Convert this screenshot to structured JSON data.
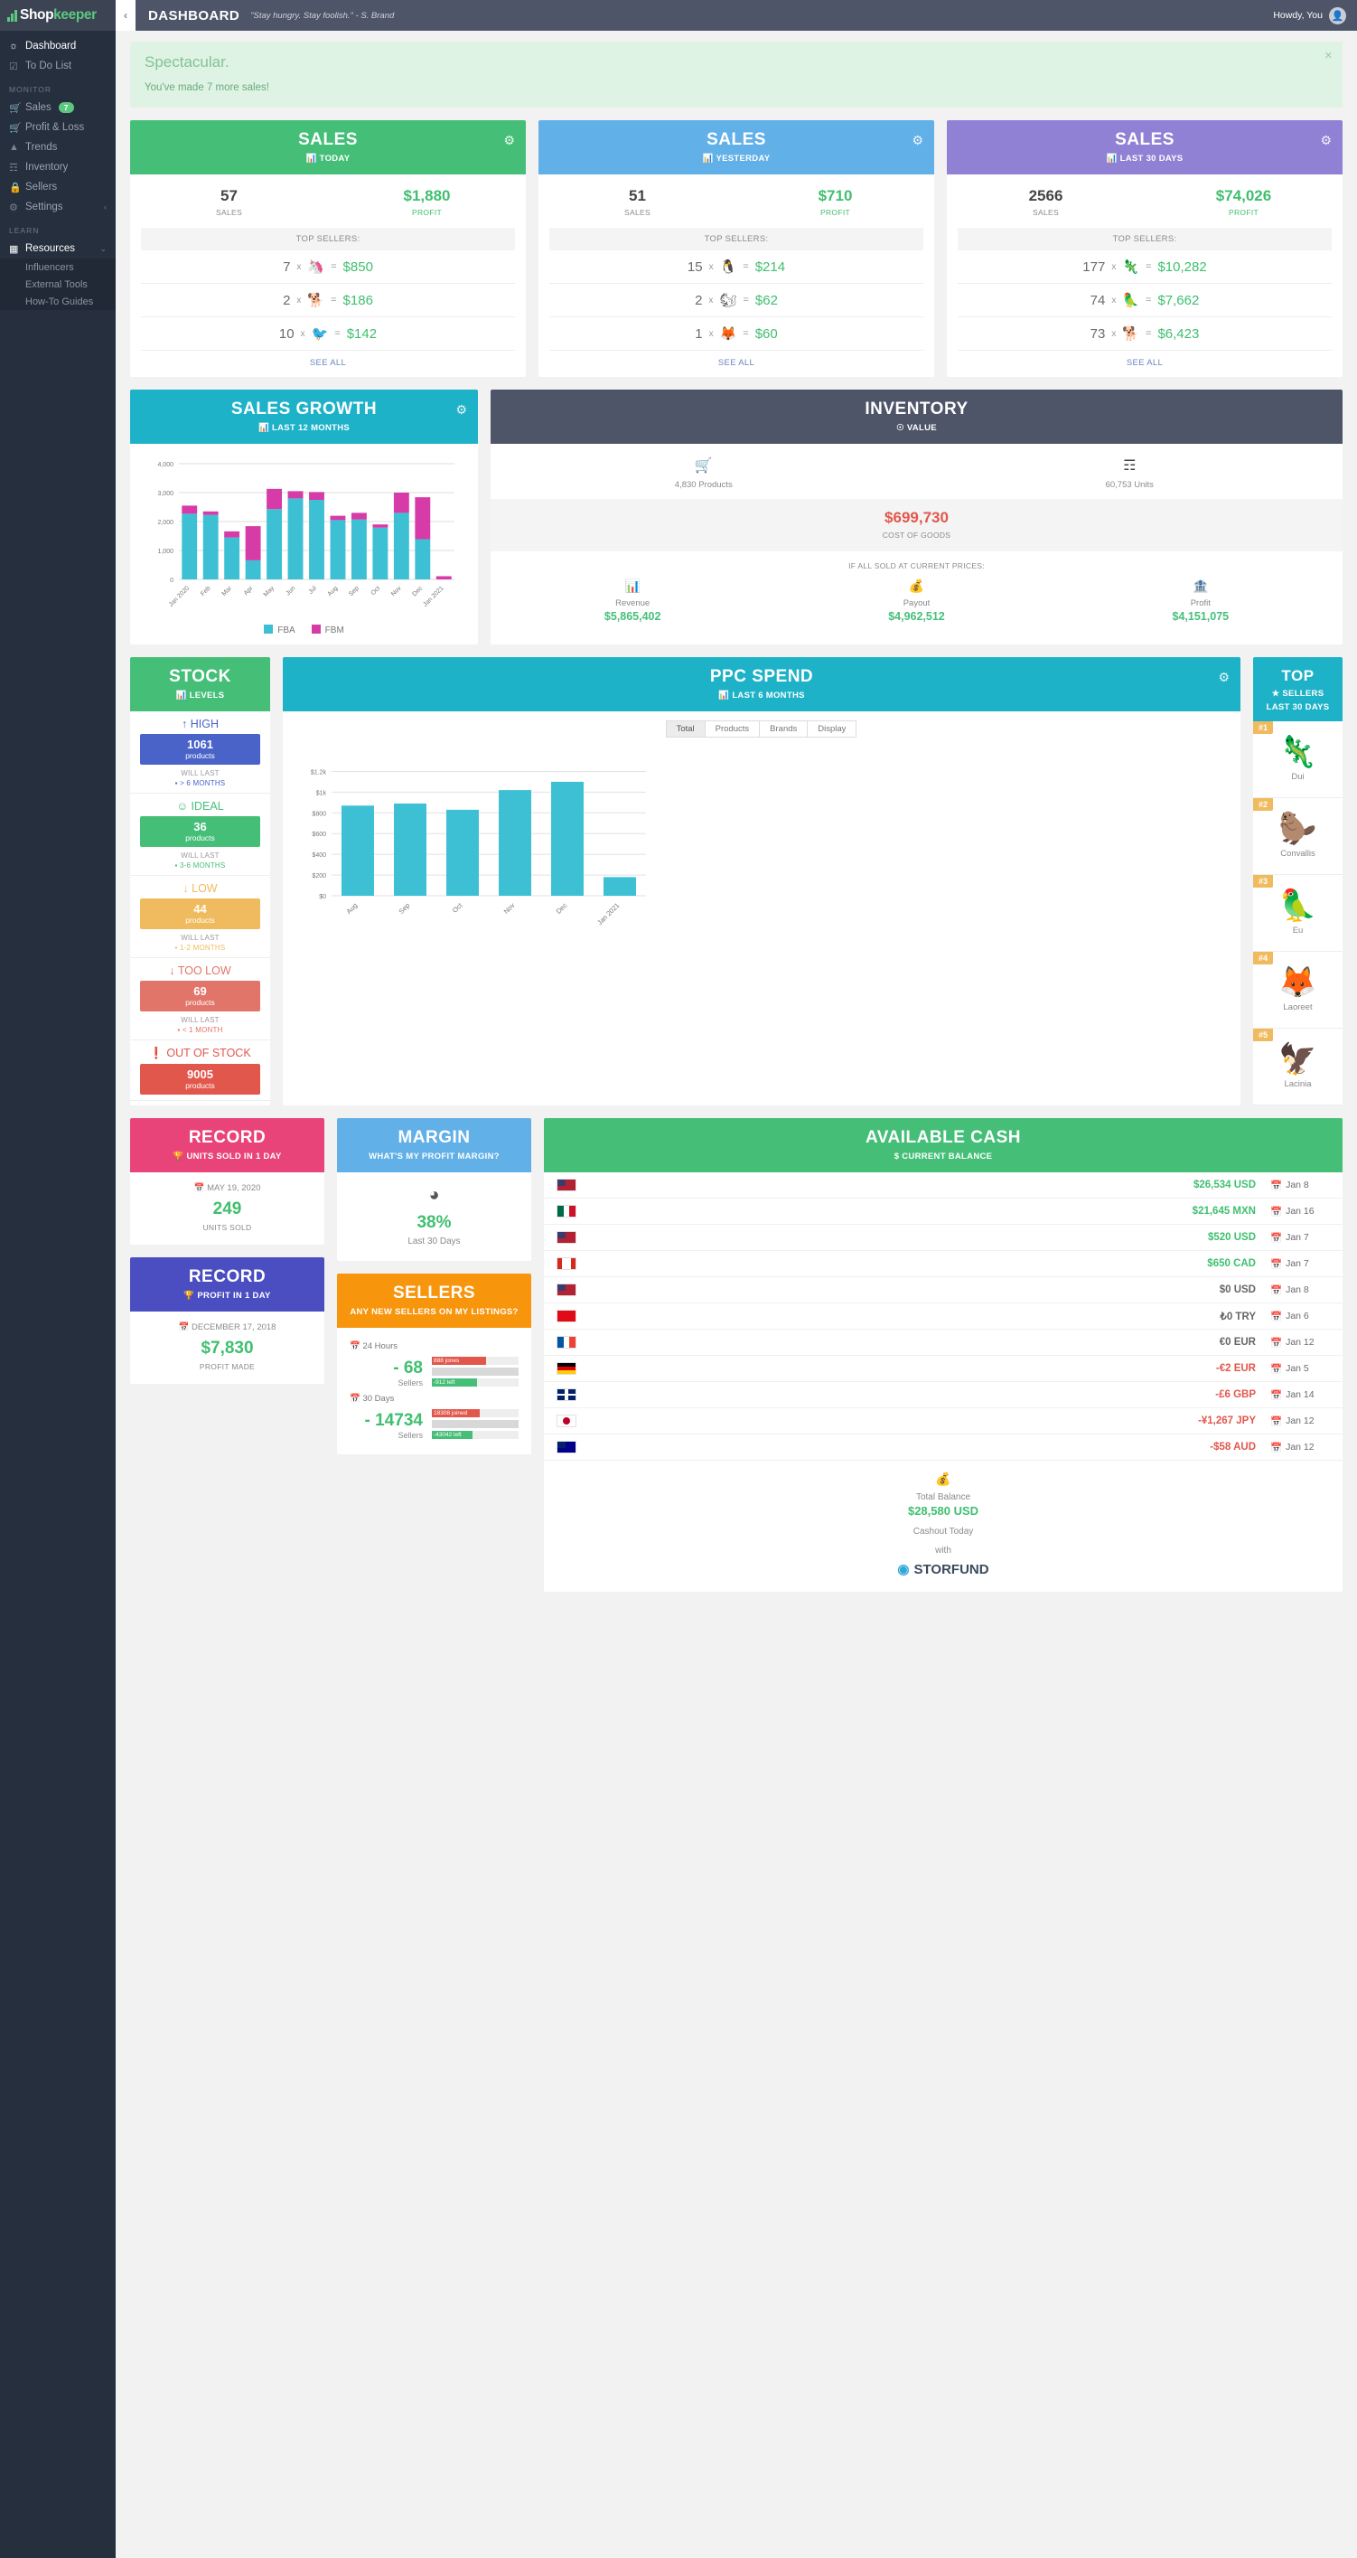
{
  "brand": {
    "word1": "Shop",
    "word2": "keeper"
  },
  "topbar": {
    "title": "DASHBOARD",
    "quote": "\"Stay hungry. Stay foolish.\" - S. Brand",
    "howdy": "Howdy, You",
    "collapse_icon": "chevron-left-icon"
  },
  "sidebar": {
    "items": [
      {
        "label": "Dashboard",
        "icon": "gauge-icon",
        "active": true
      },
      {
        "label": "To Do List",
        "icon": "checkbox-icon",
        "active": false
      }
    ],
    "monitor_label": "MONITOR",
    "monitor": [
      {
        "label": "Sales",
        "icon": "cart-icon",
        "badge": "7"
      },
      {
        "label": "Profit & Loss",
        "icon": "cart-icon",
        "badge": ""
      },
      {
        "label": "Trends",
        "icon": "chart-icon",
        "badge": ""
      },
      {
        "label": "Inventory",
        "icon": "boxes-icon",
        "badge": ""
      },
      {
        "label": "Sellers",
        "icon": "lock-icon",
        "badge": ""
      },
      {
        "label": "Settings",
        "icon": "gear-icon",
        "badge": "",
        "chevron": "‹"
      }
    ],
    "learn_label": "LEARN",
    "resources": {
      "label": "Resources",
      "icon": "grid-icon",
      "chevron": "⌄"
    },
    "sub_items": [
      {
        "label": "Influencers"
      },
      {
        "label": "External Tools"
      },
      {
        "label": "How-To Guides"
      }
    ]
  },
  "alert": {
    "title": "Spectacular.",
    "body": "You've made 7 more sales!",
    "close_icon": "close-icon"
  },
  "sales_cards": [
    {
      "title": "SALES",
      "period": "TODAY",
      "color": "#45bf78",
      "sales": "57",
      "sales_label": "SALES",
      "profit": "$1,880",
      "profit_label": "PROFIT",
      "top_label": "TOP SELLERS:",
      "rows": [
        {
          "qty": "7",
          "emoji": "🦄",
          "amount": "$850"
        },
        {
          "qty": "2",
          "emoji": "🐕",
          "amount": "$186"
        },
        {
          "qty": "10",
          "emoji": "🐦",
          "amount": "$142"
        }
      ],
      "see_all": "SEE ALL"
    },
    {
      "title": "SALES",
      "period": "YESTERDAY",
      "color": "#62b0e8",
      "sales": "51",
      "sales_label": "SALES",
      "profit": "$710",
      "profit_label": "PROFIT",
      "top_label": "TOP SELLERS:",
      "rows": [
        {
          "qty": "15",
          "emoji": "🐧",
          "amount": "$214"
        },
        {
          "qty": "2",
          "emoji": "🐿",
          "amount": "$62"
        },
        {
          "qty": "1",
          "emoji": "🦊",
          "amount": "$60"
        }
      ],
      "see_all": "SEE ALL"
    },
    {
      "title": "SALES",
      "period": "LAST 30 DAYS",
      "color": "#9181d4",
      "sales": "2566",
      "sales_label": "SALES",
      "profit": "$74,026",
      "profit_label": "PROFIT",
      "top_label": "TOP SELLERS:",
      "rows": [
        {
          "qty": "177",
          "emoji": "🦎",
          "amount": "$10,282"
        },
        {
          "qty": "74",
          "emoji": "🦜",
          "amount": "$7,662"
        },
        {
          "qty": "73",
          "emoji": "🐕",
          "amount": "$6,423"
        }
      ],
      "see_all": "SEE ALL"
    }
  ],
  "growth": {
    "title": "SALES GROWTH",
    "period": "LAST 12 MONTHS",
    "color": "#1eb2c8",
    "gear_icon": "gear-icon"
  },
  "inventory": {
    "title": "INVENTORY",
    "period": "VALUE",
    "color": "#4e5568",
    "products_value": "4,830 Products",
    "products_icon": "basket-icon",
    "units_value": "60,753 Units",
    "units_icon": "boxes-icon",
    "cost_value": "$699,730",
    "cost_label": "COST OF GOODS",
    "if_label": "IF ALL SOLD AT CURRENT PRICES:",
    "three": [
      {
        "icon": "bar-chart-icon",
        "label": "Revenue",
        "value": "$5,865,402",
        "color": "#45bf78"
      },
      {
        "icon": "money-icon",
        "label": "Payout",
        "value": "$4,962,512",
        "color": "#45bf78"
      },
      {
        "icon": "bank-icon",
        "label": "Profit",
        "value": "$4,151,075",
        "color": "#45bf78"
      }
    ]
  },
  "stock": {
    "title": "STOCK",
    "period": "LEVELS",
    "color": "#45bf78",
    "items": [
      {
        "icon": "↑",
        "name": "HIGH",
        "n": "1061",
        "u": "products",
        "color": "#4a63c8",
        "tcolor": "#4a63c8",
        "will": "WILL LAST",
        "dur": "▪ > 6 MONTHS"
      },
      {
        "icon": "☺",
        "name": "IDEAL",
        "n": "36",
        "u": "products",
        "color": "#45bf78",
        "tcolor": "#45bf78",
        "will": "WILL LAST",
        "dur": "▪ 3-6 MONTHS"
      },
      {
        "icon": "↓",
        "name": "LOW",
        "n": "44",
        "u": "products",
        "color": "#f0bb5e",
        "tcolor": "#f0bb5e",
        "will": "WILL LAST",
        "dur": "▪ 1-2 MONTHS"
      },
      {
        "icon": "↓",
        "name": "TOO LOW",
        "n": "69",
        "u": "products",
        "color": "#e2756a",
        "tcolor": "#e2756a",
        "will": "WILL LAST",
        "dur": "▪ < 1 MONTH"
      },
      {
        "icon": "❗",
        "name": "OUT OF STOCK",
        "n": "9005",
        "u": "products",
        "color": "#e2574c",
        "tcolor": "#e2574c",
        "will": "",
        "dur": ""
      }
    ]
  },
  "ppc": {
    "title": "PPC SPEND",
    "period": "LAST 6 MONTHS",
    "color": "#1eb2c8",
    "tabs": [
      {
        "label": "Total",
        "on": true
      },
      {
        "label": "Products",
        "on": false
      },
      {
        "label": "Brands",
        "on": false
      },
      {
        "label": "Display",
        "on": false
      }
    ]
  },
  "top_sellers": {
    "title": "TOP",
    "line2": "SELLERS",
    "line3": "LAST 30 DAYS",
    "color": "#1eb2c8",
    "items": [
      {
        "rank": "#1",
        "emoji": "🦎",
        "name": "Dui",
        "color": "#f0bb5e"
      },
      {
        "rank": "#2",
        "emoji": "🦫",
        "name": "Convallis",
        "color": "#f0bb5e"
      },
      {
        "rank": "#3",
        "emoji": "🦜",
        "name": "Eu",
        "color": "#f0bb5e"
      },
      {
        "rank": "#4",
        "emoji": "🦊",
        "name": "Laoreet",
        "color": "#f0bb5e"
      },
      {
        "rank": "#5",
        "emoji": "🦅",
        "name": "Lacinia",
        "color": "#f0bb5e"
      }
    ]
  },
  "record_units": {
    "title": "RECORD",
    "period": "UNITS SOLD IN 1 DAY",
    "color": "#e9447a",
    "date": "MAY 19, 2020",
    "value": "249",
    "label": "UNITS SOLD",
    "date_icon": "calendar-icon",
    "trophy_icon": "trophy-icon"
  },
  "record_profit": {
    "title": "RECORD",
    "period": "PROFIT IN 1 DAY",
    "color": "#4a4ec0",
    "date": "DECEMBER 17, 2018",
    "value": "$7,830",
    "label": "PROFIT MADE",
    "date_icon": "calendar-icon",
    "trophy_icon": "trophy-icon"
  },
  "margin": {
    "title": "MARGIN",
    "period": "WHAT'S MY PROFIT MARGIN?",
    "color": "#62b0e8",
    "value": "38%",
    "sub": "Last 30 Days",
    "pie_icon": "pie-chart-icon"
  },
  "sellers": {
    "title": "SELLERS",
    "period": "ANY NEW SELLERS ON MY LISTINGS?",
    "color": "#f7950d",
    "groups": [
      {
        "head": "24 Hours",
        "head_icon": "calendar-icon",
        "num": "- 68",
        "sub": "Sellers",
        "bars": [
          {
            "label": "888 jones",
            "pct": 62,
            "color": "#e2574c"
          },
          {
            "label": "",
            "pct": 100,
            "color": "#d8d8d8"
          },
          {
            "label": "-912 left",
            "pct": 52,
            "color": "#45bf78"
          }
        ]
      },
      {
        "head": "30 Days",
        "head_icon": "calendar-icon",
        "num": "- 14734",
        "sub": "Sellers",
        "bars": [
          {
            "label": "18308 joined",
            "pct": 55,
            "color": "#e2574c"
          },
          {
            "label": "",
            "pct": 100,
            "color": "#d8d8d8"
          },
          {
            "label": "-43042 left",
            "pct": 47,
            "color": "#45bf78"
          }
        ]
      }
    ]
  },
  "cash": {
    "title": "AVAILABLE CASH",
    "period": "CURRENT BALANCE",
    "color": "#45bf78",
    "currency_icon": "dollar-icon",
    "rows": [
      {
        "flag": "us",
        "amount": "$26,534 USD",
        "date": "Jan 8",
        "color": "#3fbf6f"
      },
      {
        "flag": "mx",
        "amount": "$21,645 MXN",
        "date": "Jan 16",
        "color": "#3fbf6f"
      },
      {
        "flag": "us",
        "amount": "$520 USD",
        "date": "Jan 7",
        "color": "#3fbf6f"
      },
      {
        "flag": "ca",
        "amount": "$650 CAD",
        "date": "Jan 7",
        "color": "#3fbf6f"
      },
      {
        "flag": "us",
        "amount": "$0 USD",
        "date": "Jan 8",
        "color": "#666"
      },
      {
        "flag": "tr",
        "amount": "₺0 TRY",
        "date": "Jan 6",
        "color": "#666"
      },
      {
        "flag": "fr",
        "amount": "€0 EUR",
        "date": "Jan 12",
        "color": "#666"
      },
      {
        "flag": "de",
        "amount": "-€2 EUR",
        "date": "Jan 5",
        "color": "#e2574c"
      },
      {
        "flag": "gb",
        "amount": "-£6 GBP",
        "date": "Jan 14",
        "color": "#e2574c"
      },
      {
        "flag": "jp",
        "amount": "-¥1,267 JPY",
        "date": "Jan 12",
        "color": "#e2574c"
      },
      {
        "flag": "au",
        "amount": "-$58 AUD",
        "date": "Jan 12",
        "color": "#e2574c"
      }
    ],
    "total_label": "Total Balance",
    "total_value": "$28,580 USD",
    "cashout_label": "Cashout Today",
    "with_label": "with",
    "partner": "STORFUND",
    "partner_icon": "storfund-logo-icon"
  },
  "chart_data": [
    {
      "type": "bar",
      "id": "sales-growth",
      "title": "SALES GROWTH",
      "subtitle": "LAST 12 MONTHS",
      "stacked": true,
      "categories": [
        "Jan 2020",
        "Feb",
        "Mar",
        "Apr",
        "May",
        "Jun",
        "Jul",
        "Aug",
        "Sep",
        "Oct",
        "Nov",
        "Dec",
        "Jan 2021"
      ],
      "series": [
        {
          "name": "FBA",
          "color": "#3dc0d4",
          "values": [
            2270,
            2230,
            1450,
            660,
            2430,
            2800,
            2750,
            2050,
            2070,
            1790,
            2300,
            1390,
            0
          ]
        },
        {
          "name": "FBM",
          "color": "#d63ba8",
          "values": [
            280,
            120,
            210,
            1180,
            700,
            250,
            270,
            150,
            230,
            110,
            700,
            1450,
            110
          ]
        }
      ],
      "ylim": [
        0,
        4000
      ],
      "yticks": [
        0,
        1000,
        2000,
        3000,
        4000
      ],
      "ytick_labels": [
        "0",
        "1,000",
        "2,000",
        "3,000",
        "4,000"
      ],
      "grid": true,
      "legend": "bottom",
      "ylabel": "",
      "xlabel": ""
    },
    {
      "type": "bar",
      "id": "ppc-spend",
      "title": "PPC SPEND",
      "subtitle": "LAST 6 MONTHS",
      "categories": [
        "Aug",
        "Sep",
        "Oct",
        "Nov",
        "Dec",
        "Jan 2021"
      ],
      "values": [
        870,
        890,
        830,
        1020,
        1100,
        180
      ],
      "color": "#3dc0d4",
      "ylim": [
        0,
        1300
      ],
      "yticks": [
        0,
        200,
        400,
        600,
        800,
        1000,
        1200
      ],
      "ytick_labels": [
        "$0",
        "$200",
        "$400",
        "$600",
        "$800",
        "$1k",
        "$1.2k"
      ],
      "grid": true,
      "ylabel": "",
      "xlabel": ""
    }
  ]
}
